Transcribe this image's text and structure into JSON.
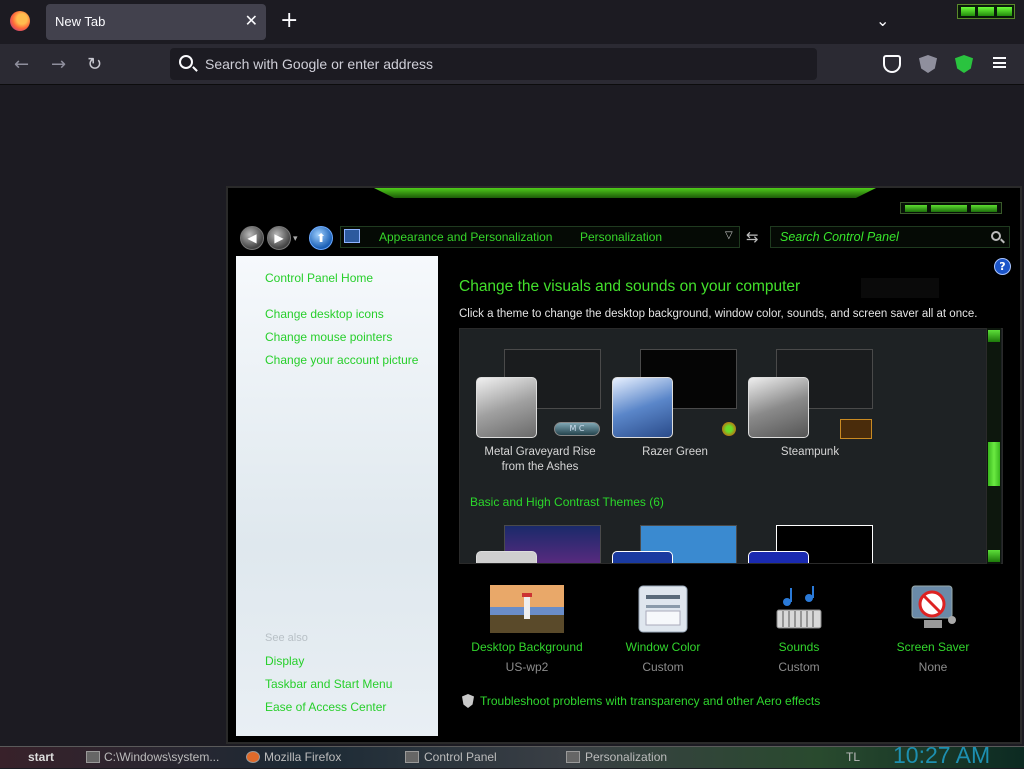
{
  "browser": {
    "tab_title": "New Tab",
    "tab_close": "✕",
    "new_tab": "+",
    "tab_list": "⌄",
    "nav_back": "←",
    "nav_forward": "→",
    "nav_reload": "↻",
    "url_placeholder": "Search with Google or enter address"
  },
  "control_panel": {
    "back": "◀",
    "forward": "▶",
    "up": "⬆",
    "addr_dropdown": "▾",
    "crumbs": [
      "Appearance and Personalization",
      "Personalization"
    ],
    "crumb_dropdown": "▽",
    "refresh": "⇆",
    "search_placeholder": "Search Control Panel",
    "help": "?",
    "sidebar": {
      "home": "Control Panel Home",
      "tasks": [
        "Change desktop icons",
        "Change mouse pointers",
        "Change your account picture"
      ],
      "see_also_heading": "See also",
      "see_also": [
        "Display",
        "Taskbar and Start Menu",
        "Ease of Access Center"
      ]
    },
    "main": {
      "title": "Change the visuals and sounds on your computer",
      "description": "Click a theme to change the desktop background, window color, sounds, and screen saver all at once.",
      "themes": [
        {
          "name_line1": "Metal Graveyard Rise",
          "name_line2": "from the Ashes",
          "swatch_text": "M C"
        },
        {
          "name_line1": "Razer Green",
          "name_line2": ""
        },
        {
          "name_line1": "Steampunk",
          "name_line2": ""
        }
      ],
      "group_label": "Basic and High Contrast Themes (6)"
    },
    "settings": [
      {
        "label": "Desktop Background",
        "value": "US-wp2",
        "icon": "landscape-icon"
      },
      {
        "label": "Window Color",
        "value": "Custom",
        "icon": "window-color-icon"
      },
      {
        "label": "Sounds",
        "value": "Custom",
        "icon": "music-notes-icon"
      },
      {
        "label": "Screen Saver",
        "value": "None",
        "icon": "screen-saver-icon"
      }
    ],
    "troubleshoot": "Troubleshoot problems with transparency and other Aero effects"
  },
  "taskbar": {
    "start": "start",
    "items": [
      "C:\\Windows\\system...",
      "Mozilla Firefox",
      "Control Panel",
      "Personalization"
    ],
    "tray": "TL",
    "clock": "10:27 AM"
  },
  "colors": {
    "accent_green": "#36d62a",
    "browser_bg": "#1c1b22",
    "toolbar_bg": "#2b2a33"
  }
}
